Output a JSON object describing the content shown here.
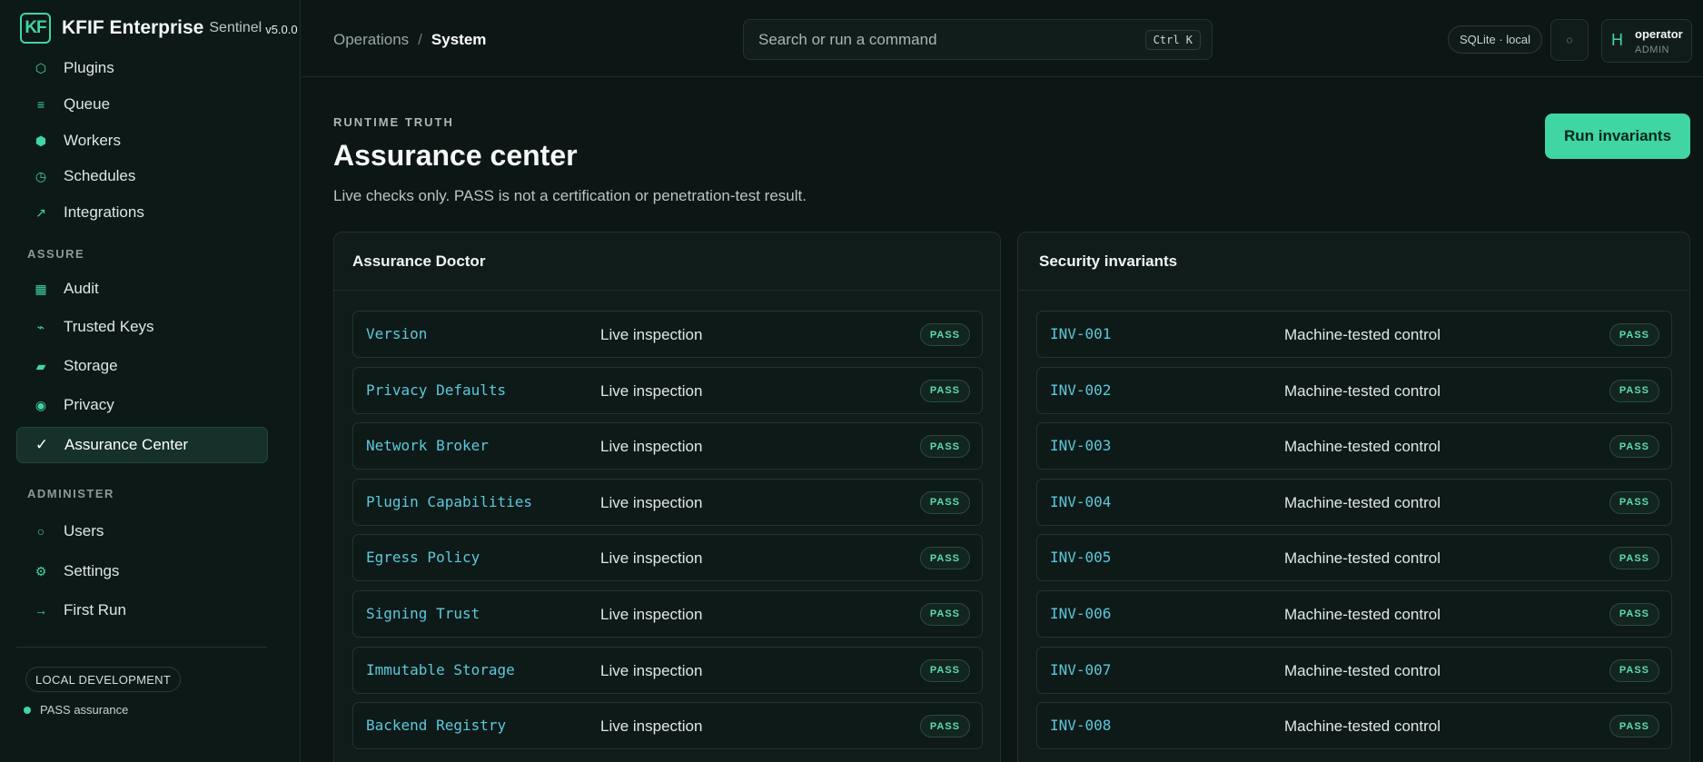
{
  "brand": {
    "logo": "KF",
    "name": "KFIF Enterprise",
    "product": "Sentinel",
    "version": "v5.0.0"
  },
  "sidebar": {
    "items_top": [
      {
        "label": "Plugins",
        "icon": "hexagon-icon"
      },
      {
        "label": "Queue",
        "icon": "list-icon"
      },
      {
        "label": "Workers",
        "icon": "hexagon-filled-icon"
      },
      {
        "label": "Schedules",
        "icon": "clock-icon"
      },
      {
        "label": "Integrations",
        "icon": "arrow-up-right-icon"
      }
    ],
    "assure_label": "ASSURE",
    "items_assure": [
      {
        "label": "Audit",
        "icon": "grid-icon"
      },
      {
        "label": "Trusted Keys",
        "icon": "key-icon"
      },
      {
        "label": "Storage",
        "icon": "storage-icon"
      },
      {
        "label": "Privacy",
        "icon": "target-icon"
      },
      {
        "label": "Assurance Center",
        "icon": "check-icon",
        "active": true
      }
    ],
    "administer_label": "ADMINISTER",
    "items_admin": [
      {
        "label": "Users",
        "icon": "circle-icon"
      },
      {
        "label": "Settings",
        "icon": "gear-icon"
      },
      {
        "label": "First Run",
        "icon": "arrow-right-icon"
      }
    ],
    "env_badge": "LOCAL DEVELOPMENT",
    "status": "PASS assurance"
  },
  "topbar": {
    "breadcrumb_parent": "Operations",
    "breadcrumb_sep": "/",
    "breadcrumb_current": "System",
    "search_placeholder": "Search or run a command",
    "search_shortcut": "Ctrl K",
    "db_badge": "SQLite · local",
    "refresh_glyph": "◌",
    "user_initial": "H",
    "user_name": "operator",
    "user_role": "ADMIN"
  },
  "main": {
    "eyebrow": "RUNTIME TRUTH",
    "title": "Assurance center",
    "subtitle": "Live checks only. PASS is not a certification or penetration-test result.",
    "run_button": "Run invariants"
  },
  "doctor": {
    "title": "Assurance Doctor",
    "rows": [
      {
        "key": "Version",
        "desc": "Live inspection",
        "status": "PASS"
      },
      {
        "key": "Privacy Defaults",
        "desc": "Live inspection",
        "status": "PASS"
      },
      {
        "key": "Network Broker",
        "desc": "Live inspection",
        "status": "PASS"
      },
      {
        "key": "Plugin Capabilities",
        "desc": "Live inspection",
        "status": "PASS"
      },
      {
        "key": "Egress Policy",
        "desc": "Live inspection",
        "status": "PASS"
      },
      {
        "key": "Signing Trust",
        "desc": "Live inspection",
        "status": "PASS"
      },
      {
        "key": "Immutable Storage",
        "desc": "Live inspection",
        "status": "PASS"
      },
      {
        "key": "Backend Registry",
        "desc": "Live inspection",
        "status": "PASS"
      }
    ]
  },
  "invariants": {
    "title": "Security invariants",
    "rows": [
      {
        "key": "INV-001",
        "desc": "Machine-tested control",
        "status": "PASS"
      },
      {
        "key": "INV-002",
        "desc": "Machine-tested control",
        "status": "PASS"
      },
      {
        "key": "INV-003",
        "desc": "Machine-tested control",
        "status": "PASS"
      },
      {
        "key": "INV-004",
        "desc": "Machine-tested control",
        "status": "PASS"
      },
      {
        "key": "INV-005",
        "desc": "Machine-tested control",
        "status": "PASS"
      },
      {
        "key": "INV-006",
        "desc": "Machine-tested control",
        "status": "PASS"
      },
      {
        "key": "INV-007",
        "desc": "Machine-tested control",
        "status": "PASS"
      },
      {
        "key": "INV-008",
        "desc": "Machine-tested control",
        "status": "PASS"
      }
    ]
  },
  "colors": {
    "accent": "#3fd6a3",
    "background": "#0c1614",
    "mono_text": "#5cc8dc"
  }
}
